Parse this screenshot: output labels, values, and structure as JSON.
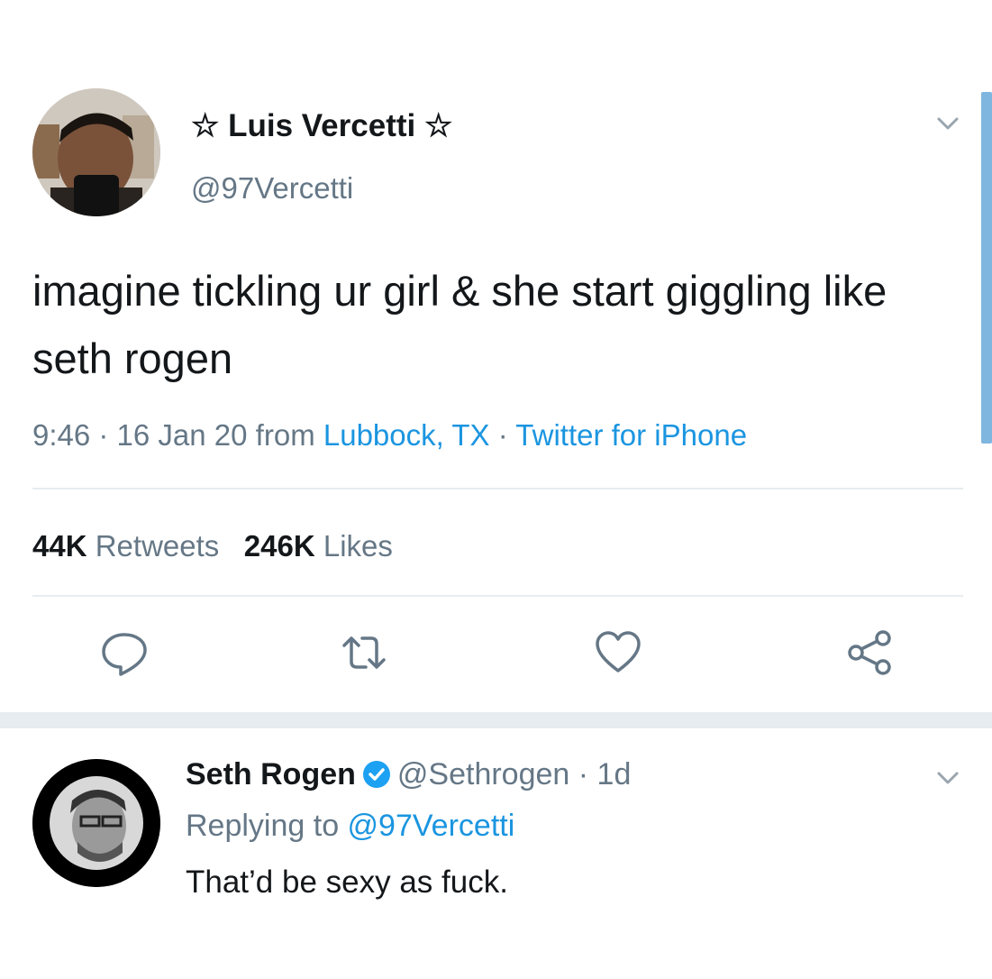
{
  "tweet": {
    "author_name": "☆ Luis Vercetti ☆",
    "handle": "@97Vercetti",
    "text": "imagine tickling ur girl & she start giggling like seth rogen",
    "time": "9:46 · 16 Jan 20 from ",
    "location": "Lubbock, TX",
    "sep": " · ",
    "source": "Twitter for iPhone",
    "retweets_count": "44K",
    "retweets_label": "Retweets",
    "likes_count": "246K",
    "likes_label": "Likes"
  },
  "actions": {
    "icons": [
      "reply-icon",
      "retweet-icon",
      "like-icon",
      "share-icon"
    ]
  },
  "reply": {
    "author_name": "Seth Rogen",
    "handle_time": "@Sethrogen · 1d",
    "replying_prefix": "Replying to ",
    "replying_to": "@97Vercetti",
    "text": "That’d be sexy as fuck."
  },
  "colors": {
    "link": "#1b95e0",
    "secondary_text": "#657786",
    "divider": "#e6ecf0"
  }
}
